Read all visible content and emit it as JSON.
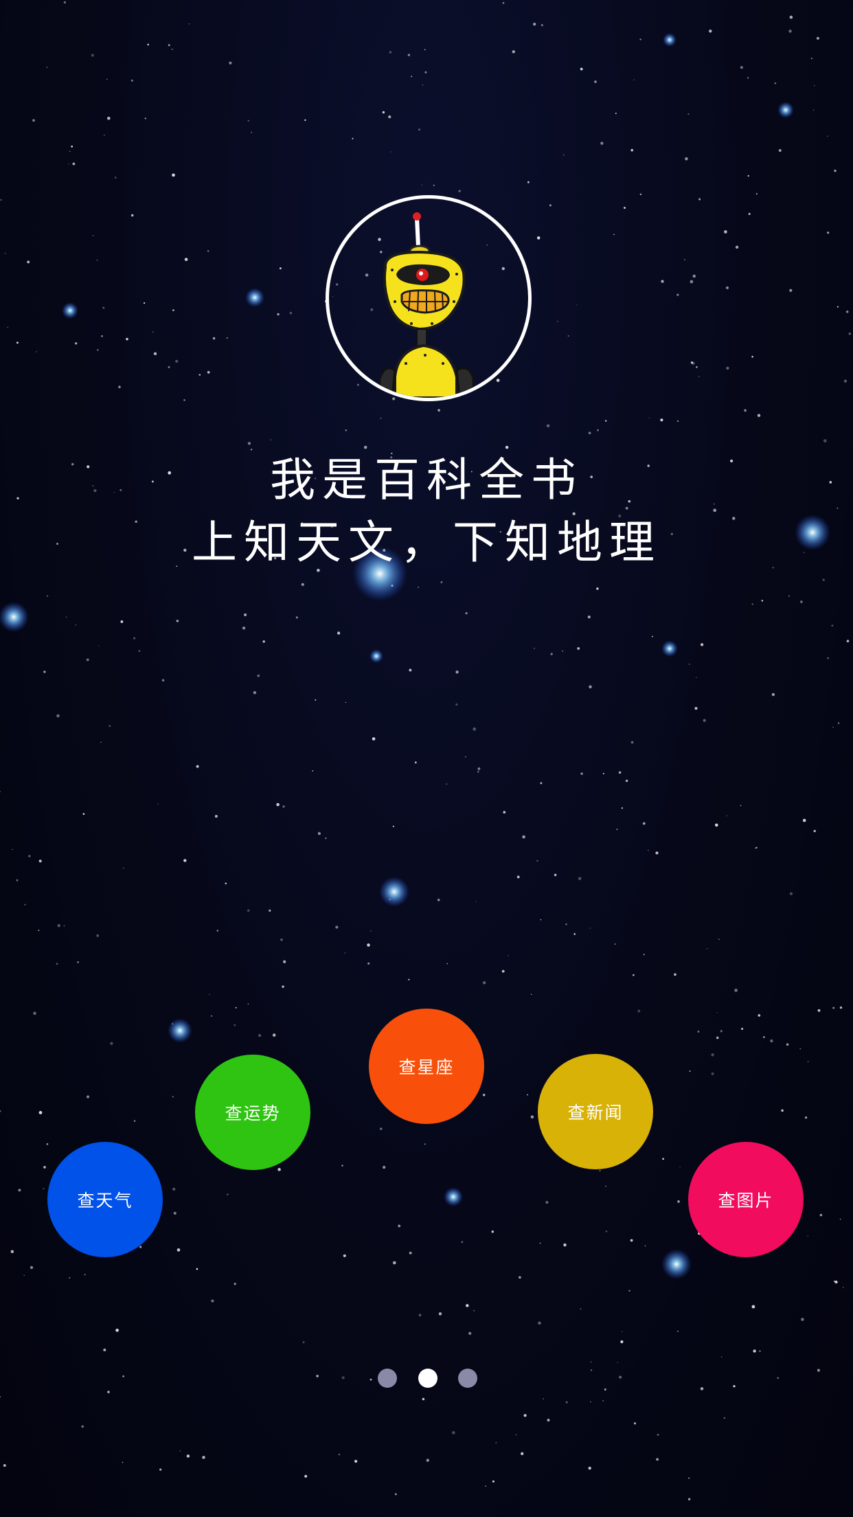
{
  "headline": {
    "line1": "我是百科全书",
    "line2": "上知天文，下知地理"
  },
  "avatar": {
    "icon": "robot-icon"
  },
  "actions": [
    {
      "key": "weather",
      "label": "查天气",
      "color": "#0052e9"
    },
    {
      "key": "fortune",
      "label": "查运势",
      "color": "#2fc412"
    },
    {
      "key": "horoscope",
      "label": "查星座",
      "color": "#f8500b"
    },
    {
      "key": "news",
      "label": "查新闻",
      "color": "#d9b208"
    },
    {
      "key": "images",
      "label": "查图片",
      "color": "#f20c5e"
    }
  ],
  "pager": {
    "count": 3,
    "active_index": 1
  },
  "colors": {
    "background": "#050716",
    "dot_inactive": "#8a8aa8",
    "dot_active": "#ffffff"
  }
}
